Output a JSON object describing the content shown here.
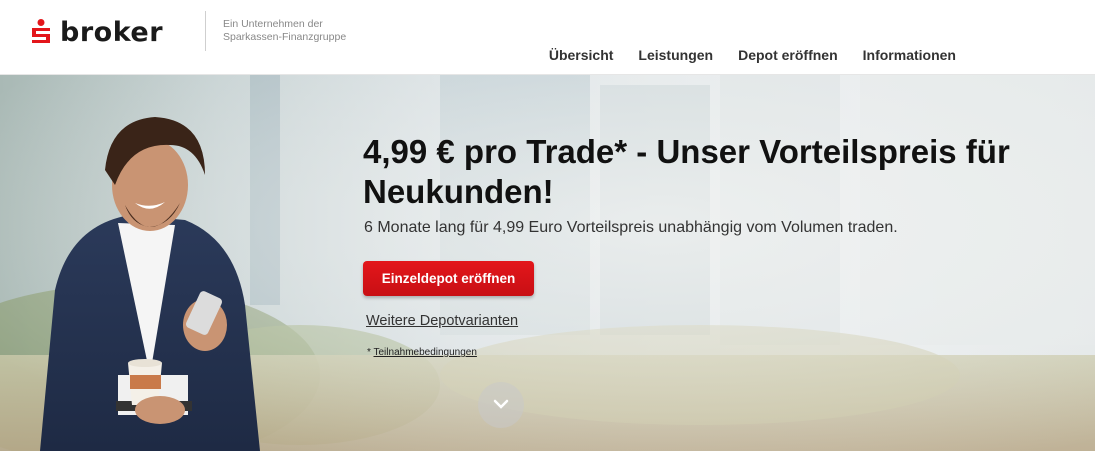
{
  "header": {
    "logo_text": "broker",
    "tagline_line1": "Ein Unternehmen der",
    "tagline_line2": "Sparkassen-Finanzgruppe",
    "nav": [
      {
        "label": "Übersicht"
      },
      {
        "label": "Leistungen"
      },
      {
        "label": "Depot eröffnen"
      },
      {
        "label": "Informationen"
      }
    ]
  },
  "hero": {
    "headline_line1": "4,99 € pro Trade* - Unser Vorteilspreis für",
    "headline_line2": "Neukunden!",
    "subline": "6 Monate lang für 4,99 Euro Vorteilspreis unabhängig vom Volumen traden.",
    "cta_label": "Einzeldepot eröffnen",
    "more_link": "Weitere Depotvarianten",
    "terms_prefix": "* ",
    "terms_link": "Teilnahmebedingungen"
  },
  "colors": {
    "brand_red": "#e3161b",
    "text_dark": "#111111"
  },
  "icons": {
    "logo": "sparkasse-s-logo-icon",
    "scroll": "chevron-down-icon"
  }
}
